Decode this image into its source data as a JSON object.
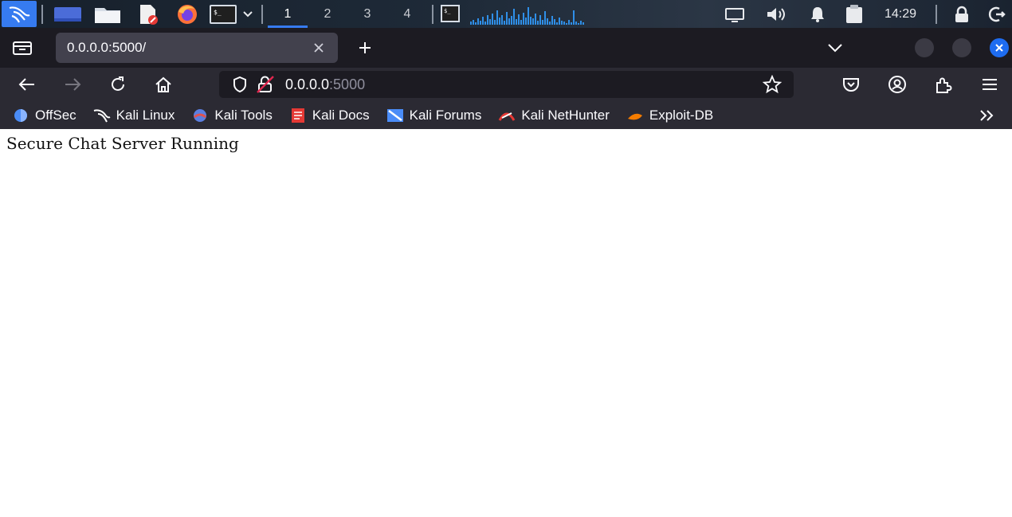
{
  "panel": {
    "workspaces": [
      "1",
      "2",
      "3",
      "4"
    ],
    "active_workspace": "1",
    "clock": "14:29",
    "accent": "#367bf0",
    "icons": [
      "kali-menu-icon",
      "desktop-icon",
      "file-manager-icon",
      "text-editor-icon",
      "firefox-icon",
      "terminal-icon",
      "dropdown-icon",
      "terminal-window-icon",
      "cpu-graph",
      "display-icon",
      "volume-icon",
      "bell-icon",
      "clipboard-icon",
      "lock-icon",
      "logout-icon"
    ]
  },
  "tab": {
    "title": "0.0.0.0:5000/"
  },
  "urlbar": {
    "host": "0.0.0.0",
    "port": ":5000"
  },
  "bookmarks": [
    {
      "label": "OffSec",
      "icon": "offsec-icon",
      "color": "#4a8cf7"
    },
    {
      "label": "Kali Linux",
      "icon": "kali-dragon-icon",
      "color": "#ffffff"
    },
    {
      "label": "Kali Tools",
      "icon": "kali-tools-icon",
      "color": "#e0524f"
    },
    {
      "label": "Kali Docs",
      "icon": "kali-docs-icon",
      "color": "#e53935"
    },
    {
      "label": "Kali Forums",
      "icon": "kali-forums-icon",
      "color": "#4a8cf7"
    },
    {
      "label": "Kali NetHunter",
      "icon": "nethunter-icon",
      "color": "#e53935"
    },
    {
      "label": "Exploit-DB",
      "icon": "exploitdb-icon",
      "color": "#f57c00"
    }
  ],
  "page": {
    "text": "Secure Chat Server Running"
  }
}
